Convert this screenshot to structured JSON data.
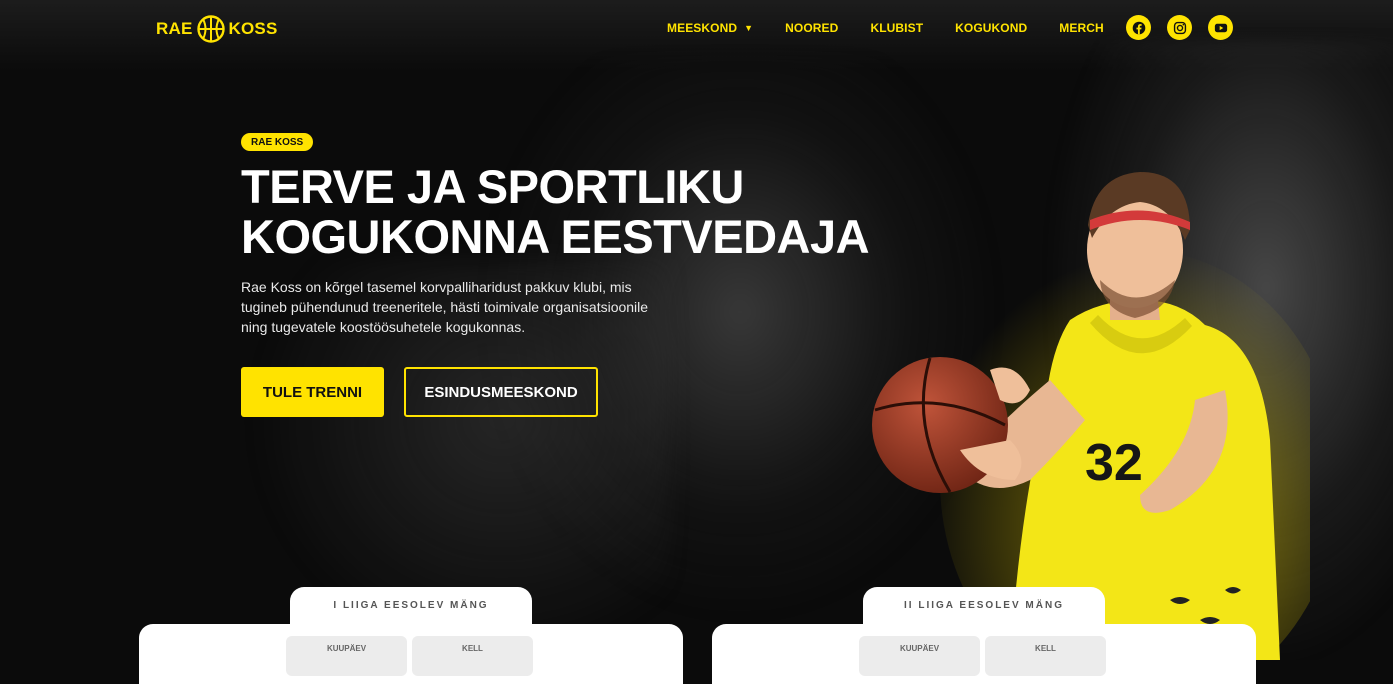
{
  "brand": {
    "left": "RAE",
    "right": "KOSS",
    "accent": "#ffe300"
  },
  "nav": {
    "items": [
      {
        "label": "MEESKOND",
        "has_dropdown": true
      },
      {
        "label": "NOORED"
      },
      {
        "label": "KLUBIST"
      },
      {
        "label": "KOGUKOND"
      },
      {
        "label": "MERCH"
      }
    ],
    "socials": [
      {
        "icon": "facebook-icon"
      },
      {
        "icon": "instagram-icon"
      },
      {
        "icon": "youtube-icon"
      }
    ]
  },
  "hero": {
    "badge": "RAE KOSS",
    "headline_line1": "TERVE JA SPORTLIKU",
    "headline_line2": "KOGUKONNA EESTVEDAJA",
    "lead": "Rae Koss on kõrgel tasemel korvpalliharidust pakkuv klubi, mis tugineb pühendunud treeneritele, hästi toimivale organisatsioonile ning tugevatele koostöösuhetele kogukonnas.",
    "primary_button": "TULE TRENNI",
    "secondary_button": "ESINDUSMEESKOND",
    "player_number": "32"
  },
  "matches": [
    {
      "title": "I LIIGA EESOLEV MÄNG",
      "day_label": "KUUPÄEV",
      "time_label": "KELL"
    },
    {
      "title": "II LIIGA EESOLEV MÄNG",
      "day_label": "KUUPÄEV",
      "time_label": "KELL"
    }
  ]
}
